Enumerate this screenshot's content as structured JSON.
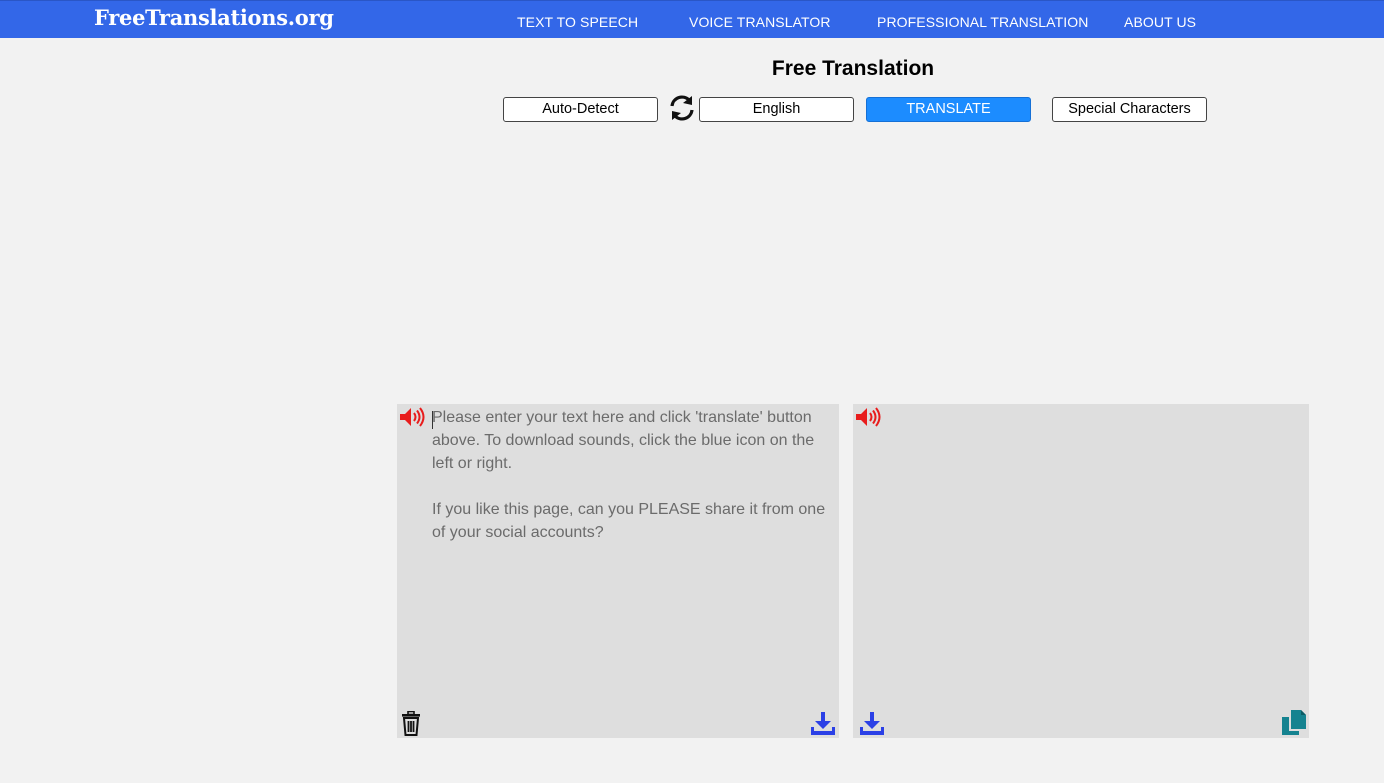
{
  "header": {
    "logo_text": "FreeTranslations.org",
    "nav": [
      {
        "label": "TEXT TO SPEECH"
      },
      {
        "label": "VOICE TRANSLATOR"
      },
      {
        "label": "PROFESSIONAL TRANSLATION"
      },
      {
        "label": "ABOUT US"
      }
    ],
    "background_color": "#3367e8"
  },
  "main": {
    "title": "Free Translation",
    "source_language": "Auto-Detect",
    "target_language": "English",
    "translate_label": "TRANSLATE",
    "special_chars_label": "Special Characters",
    "accent_color": "#1c8cff"
  },
  "source_panel": {
    "placeholder": "Please enter your text here and click 'translate' button above. To download sounds, click the blue icon on the left or right.\n\nIf you like this page, can you PLEASE share it from one of your social accounts?",
    "value": "",
    "icons": {
      "speaker": "speaker-icon",
      "delete": "trash-icon",
      "download": "download-icon"
    }
  },
  "target_panel": {
    "value": "",
    "icons": {
      "speaker": "speaker-icon",
      "download": "download-icon",
      "copy": "copy-icon"
    }
  },
  "colors": {
    "speaker": "#e81c1c",
    "download": "#2b40e6",
    "copy": "#158390",
    "panel_bg": "#dedede",
    "page_bg": "#f2f2f2"
  }
}
